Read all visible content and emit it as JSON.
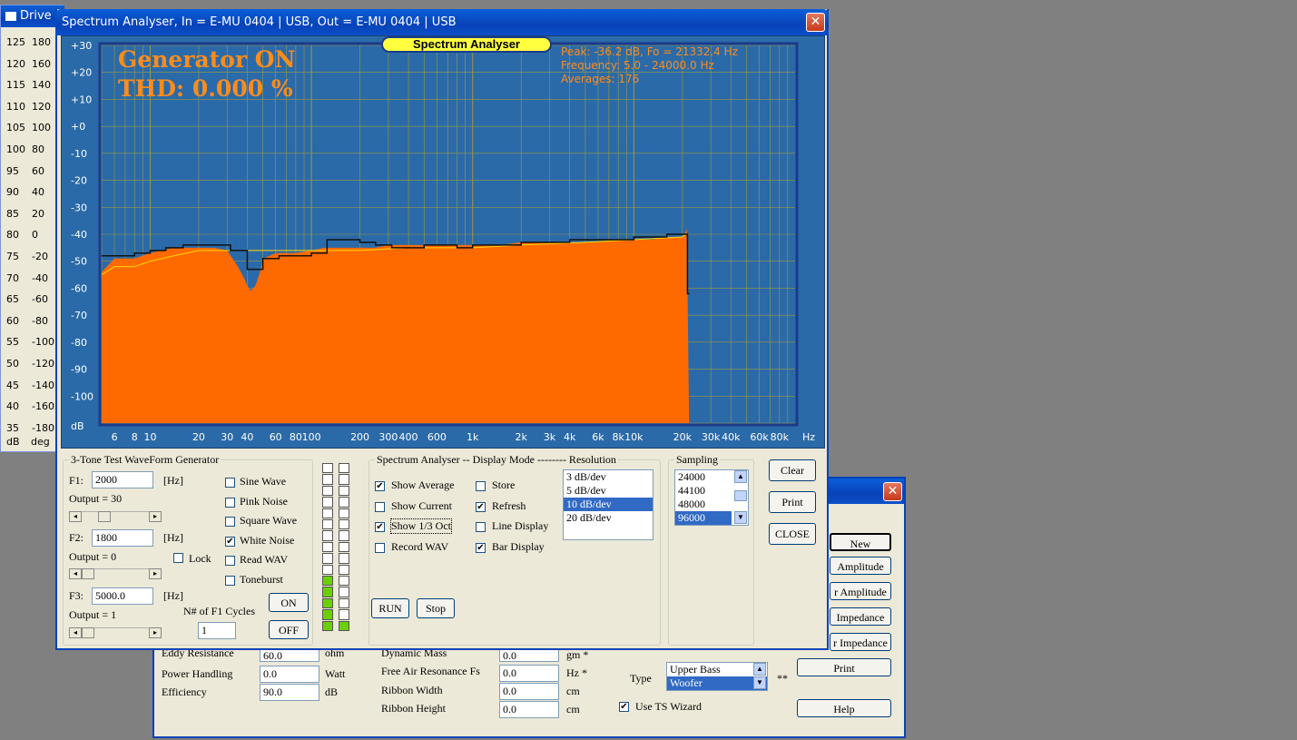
{
  "driver_window": {
    "title": "Drive",
    "left_scale": [
      [
        "125",
        "180"
      ],
      [
        "120",
        "160"
      ],
      [
        "115",
        "140"
      ],
      [
        "110",
        "120"
      ],
      [
        "105",
        "100"
      ],
      [
        "100",
        "80"
      ],
      [
        "95",
        "60"
      ],
      [
        "90",
        "40"
      ],
      [
        "85",
        "20"
      ],
      [
        "80",
        "0"
      ],
      [
        "75",
        "-20"
      ],
      [
        "70",
        "-40"
      ],
      [
        "65",
        "-60"
      ],
      [
        "60",
        "-80"
      ],
      [
        "55",
        "-100"
      ],
      [
        "50",
        "-120"
      ],
      [
        "45",
        "-140"
      ],
      [
        "40",
        "-160"
      ],
      [
        "35",
        "-180"
      ]
    ],
    "unit_db": "dB",
    "unit_deg": "deg"
  },
  "back_window": {
    "buttons": [
      "New",
      "Amplitude",
      "r Amplitude",
      "Impedance",
      "r Impedance",
      "Print",
      "Help"
    ],
    "fields_left": [
      {
        "label": "Eddy Resistance",
        "value": "60.0",
        "unit": "ohm"
      },
      {
        "label": "Power Handling",
        "value": "0.0",
        "unit": "Watt"
      },
      {
        "label": "Efficiency",
        "value": "90.0",
        "unit": "dB"
      }
    ],
    "fields_mid": [
      {
        "label": "Dynamic Mass",
        "value": "0.0",
        "unit": "gm *"
      },
      {
        "label": "Free Air Resonance Fs",
        "value": "0.0",
        "unit": "Hz  *"
      },
      {
        "label": "Ribbon Width",
        "value": "0.0",
        "unit": "cm"
      },
      {
        "label": "Ribbon Height",
        "value": "0.0",
        "unit": "cm"
      }
    ],
    "type_label": "Type",
    "type_options": [
      "Upper Bass",
      "Woofer"
    ],
    "type_selected": "Woofer",
    "type_mark": "**",
    "use_ts_wizard": "Use TS Wizard"
  },
  "analyser": {
    "title": "Spectrum Analyser, In = E-MU 0404 | USB, Out = E-MU 0404 | USB",
    "chart_badge": "Spectrum Analyser",
    "generator_text": "Generator ON",
    "thd_text": "THD: 0.000 %",
    "peak_text": "Peak: -36.2 dB, Fo = 21332.4 Hz",
    "freq_text": "Frequency: 5.0 - 24000.0 Hz",
    "avg_text": "Averages: 176",
    "colors": {
      "plot_bg": "#2b6aa8",
      "fill": "#ff6a00",
      "avg_line": "#ffd800",
      "current_line": "#000000",
      "grid": "#9a9a40",
      "text": "#ff8c1a"
    },
    "generator": {
      "title": "3-Tone Test WaveForm Generator",
      "f1_label": "F1:",
      "f1_value": "2000",
      "f1_unit": "[Hz]",
      "out1": "Output = 30",
      "f2_label": "F2:",
      "f2_value": "1800",
      "f2_unit": "[Hz]",
      "out2": "Output = 0",
      "f3_label": "F3:",
      "f3_value": "5000.0",
      "f3_unit": "[Hz]",
      "out3": "Output = 1",
      "lock": "Lock",
      "waves": [
        {
          "label": "Sine Wave",
          "checked": false
        },
        {
          "label": "Pink Noise",
          "checked": false
        },
        {
          "label": "Square Wave",
          "checked": false
        },
        {
          "label": "White Noise",
          "checked": true
        },
        {
          "label": "Read WAV",
          "checked": false
        },
        {
          "label": "Toneburst",
          "checked": false
        }
      ],
      "cycles_label": "N# of F1 Cycles",
      "cycles_value": "1",
      "on": "ON",
      "off": "OFF"
    },
    "display_mode": {
      "title": "Spectrum Analyser -- Display Mode -------- Resolution",
      "options": [
        {
          "label": "Show Average",
          "checked": true
        },
        {
          "label": "Store",
          "checked": false
        },
        {
          "label": "Show Current",
          "checked": false
        },
        {
          "label": "Refresh",
          "checked": true
        },
        {
          "label": "Show 1/3 Oct",
          "checked": true
        },
        {
          "label": "Line Display",
          "checked": false
        },
        {
          "label": "Record WAV",
          "checked": false
        },
        {
          "label": "Bar Display",
          "checked": true
        }
      ],
      "resolution": [
        "3 dB/dev",
        "5 dB/dev",
        "10 dB/dev",
        "20 dB/dev"
      ],
      "resolution_selected": "10 dB/dev",
      "run": "RUN",
      "stop": "Stop"
    },
    "sampling": {
      "title": "Sampling",
      "options": [
        "24000",
        "44100",
        "48000",
        "96000"
      ],
      "selected": "96000"
    },
    "buttons": {
      "clear": "Clear",
      "print": "Print",
      "close": "CLOSE"
    },
    "vu_meter": {
      "left_level": 0.32,
      "right_level": 0.06
    }
  },
  "chart_data": {
    "type": "area",
    "title": "Spectrum Analyser",
    "xlabel": "Hz",
    "ylabel": "dB",
    "x_scale": "log",
    "xlim": [
      5,
      100000
    ],
    "ylim": [
      -110,
      30
    ],
    "y_ticks": [
      "+30",
      "+20",
      "+10",
      "+0",
      "-10",
      "-20",
      "-30",
      "-40",
      "-50",
      "-60",
      "-70",
      "-80",
      "-90",
      "-100"
    ],
    "x_ticks": [
      {
        "v": 6,
        "t": "6"
      },
      {
        "v": 8,
        "t": "8"
      },
      {
        "v": 10,
        "t": "10"
      },
      {
        "v": 20,
        "t": "20"
      },
      {
        "v": 30,
        "t": "30"
      },
      {
        "v": 40,
        "t": "40"
      },
      {
        "v": 60,
        "t": "60"
      },
      {
        "v": 80,
        "t": "80"
      },
      {
        "v": 100,
        "t": "100"
      },
      {
        "v": 200,
        "t": "200"
      },
      {
        "v": 300,
        "t": "300"
      },
      {
        "v": 400,
        "t": "400"
      },
      {
        "v": 600,
        "t": "600"
      },
      {
        "v": 1000,
        "t": "1k"
      },
      {
        "v": 2000,
        "t": "2k"
      },
      {
        "v": 3000,
        "t": "3k"
      },
      {
        "v": 4000,
        "t": "4k"
      },
      {
        "v": 6000,
        "t": "6k"
      },
      {
        "v": 8000,
        "t": "8k"
      },
      {
        "v": 10000,
        "t": "10k"
      },
      {
        "v": 20000,
        "t": "20k"
      },
      {
        "v": 30000,
        "t": "30k"
      },
      {
        "v": 40000,
        "t": "40k"
      },
      {
        "v": 60000,
        "t": "60k"
      },
      {
        "v": 80000,
        "t": "80k"
      }
    ],
    "grid": true,
    "spectrum": {
      "x": [
        5,
        6,
        8,
        10,
        14,
        20,
        25,
        30,
        35,
        38,
        40,
        42,
        45,
        48,
        50,
        55,
        60,
        80,
        100,
        120,
        150,
        200,
        250,
        300,
        400,
        500,
        600,
        700,
        800,
        1000,
        1500,
        2000,
        3000,
        4000,
        5000,
        6000,
        8000,
        10000,
        13000,
        16000,
        19000,
        20000,
        21000,
        21300,
        22000
      ],
      "y": [
        -54,
        -49,
        -49,
        -47,
        -45,
        -45,
        -45,
        -46,
        -52,
        -56,
        -59,
        -61,
        -59,
        -54,
        -49,
        -48,
        -47,
        -47,
        -46,
        -45,
        -45,
        -45,
        -45,
        -44,
        -44,
        -44,
        -44,
        -44,
        -44,
        -44,
        -44,
        -43,
        -43,
        -43,
        -43,
        -43,
        -42,
        -42,
        -42,
        -41,
        -41,
        -41,
        -39,
        -38,
        -110
      ]
    },
    "average_line": {
      "x": [
        5,
        6,
        8,
        10,
        14,
        20,
        30,
        40,
        60,
        100,
        200,
        400,
        1000,
        2000,
        5000,
        10000,
        20000,
        21000
      ],
      "y": [
        -55,
        -52,
        -52,
        -50,
        -48,
        -46,
        -46,
        -46,
        -46,
        -46,
        -46,
        -45,
        -45,
        -44,
        -43,
        -42,
        -41,
        -40
      ]
    },
    "third_octave": {
      "x": [
        5,
        6.3,
        8,
        10,
        12.5,
        16,
        20,
        25,
        31.5,
        40,
        50,
        63,
        80,
        100,
        125,
        160,
        200,
        250,
        315,
        400,
        500,
        630,
        800,
        1000,
        1250,
        1600,
        2000,
        2500,
        3150,
        4000,
        5000,
        6300,
        8000,
        10000,
        12500,
        16000,
        20000,
        21500
      ],
      "y": [
        -48,
        -48,
        -47,
        -46,
        -45,
        -44,
        -44,
        -44,
        -46,
        -53,
        -49,
        -48,
        -48,
        -47,
        -42,
        -42,
        -43,
        -44,
        -45,
        -45,
        -44,
        -44,
        -45,
        -44,
        -44,
        -44,
        -43,
        -43,
        -43,
        -42,
        -42,
        -42,
        -42,
        -41,
        -41,
        -40,
        -40,
        -62
      ]
    }
  }
}
